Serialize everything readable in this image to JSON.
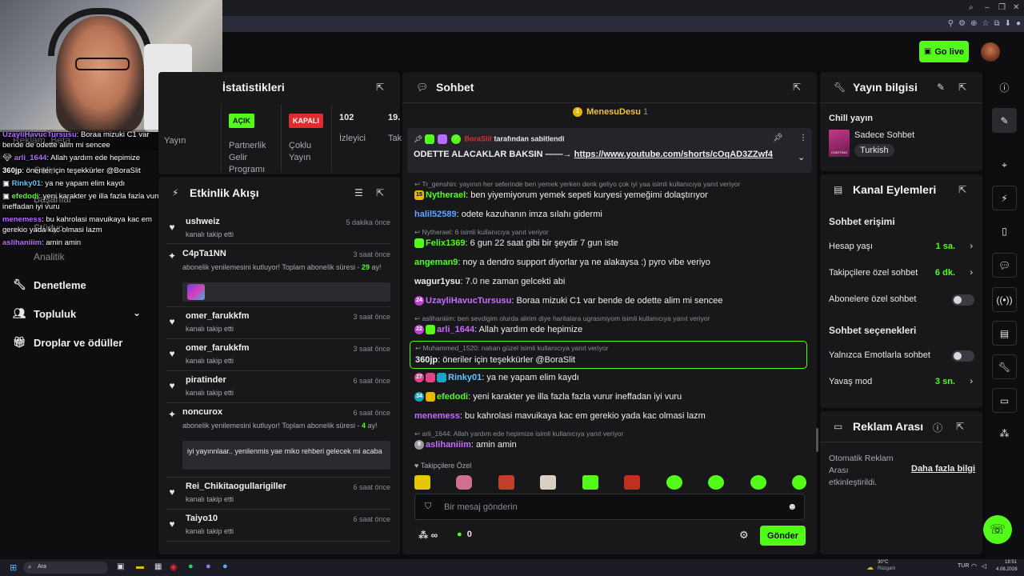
{
  "overlay_chat": [
    {
      "user": "UzayliHavucTursusu",
      "text": ": Boraa mizuki C1 var bende de odette alim mi sencee",
      "color": "#b56cff"
    },
    {
      "user": "arli_1644",
      "text": ": Allah yardım ede hepimize",
      "color": "#b56cff"
    },
    {
      "user": "360jp",
      "text": ": öneriler için teşekkürler @BoraSlit",
      "color": "#ffffff"
    },
    {
      "user": "Rinky01",
      "text": ": ya ne yapam elim kaydı",
      "color": "#5cc8ff"
    },
    {
      "user": "efedodi",
      "text": ": yeni karakter ye illa fazla fazla vurur ineffadan iyi vuru",
      "color": "#53fc18"
    },
    {
      "user": "menemess",
      "text": ": bu kahrolasi mavuikaya kac em gerekio yada kac olmasi lazm",
      "color": "#b56cff"
    },
    {
      "user": "aslihaniiim",
      "text": ": amin amin",
      "color": "#b56cff"
    }
  ],
  "nav": {
    "hidden_items": [
      "Reklam",
      "Beta",
      "Gelir",
      "Başarılar",
      "Stüdyo",
      "Analitik"
    ],
    "items": [
      {
        "label": "Denetleme",
        "icon": "wrench-icon"
      },
      {
        "label": "Topluluk",
        "icon": "users-icon"
      },
      {
        "label": "Droplar ve ödüller",
        "icon": "gift-icon"
      }
    ]
  },
  "header": {
    "go_live": "Go live"
  },
  "stats": {
    "title": "İstatistikleri",
    "col0": "Yayın",
    "cols": [
      {
        "tag": "AÇIK",
        "tag_color": "#53fc18",
        "label": "Partnerlik Gelir Programı"
      },
      {
        "tag": "KAPALI",
        "tag_color": "#e02c2c",
        "label": "Çoklu Yayın"
      },
      {
        "value": "102",
        "label": "İzleyici"
      },
      {
        "value": "19.",
        "label": "Tak"
      }
    ]
  },
  "activity": {
    "title": "Etkinlik Akışı",
    "rows": [
      {
        "name": "ushweiz",
        "sub": "kanalı takip etti",
        "time": "5 dakika önce",
        "icon": "heart-icon"
      },
      {
        "name": "C4pTa1NN",
        "sub": "abonelik yenilemesini kutluyor! Toplam abonelik süresi - ",
        "months": "29",
        "sub2": "ay!",
        "time": "3 saat önce",
        "icon": "star-icon"
      },
      {
        "name": "omer_farukkfm",
        "sub": "kanalı takip etti",
        "time": "3 saat önce",
        "icon": "heart-icon"
      },
      {
        "name": "omer_farukkfm",
        "sub": "kanalı takip etti",
        "time": "3 saat önce",
        "icon": "heart-icon"
      },
      {
        "name": "piratinder",
        "sub": "kanalı takip etti",
        "time": "6 saat önce",
        "icon": "heart-icon"
      },
      {
        "name": "noncurox",
        "sub": "abonelik yenilemesini kutluyor! Toplam abonelik süresi - ",
        "months": "4",
        "sub2": "ay!",
        "note": "iyi yayınnlaar.. yenilenmis yae miko rehberi gelecek mi acaba",
        "time": "6 saat önce",
        "icon": "star-icon"
      },
      {
        "name": "Rei_Chikitaogullarigiller",
        "sub": "kanalı takip etti",
        "time": "6 saat önce",
        "icon": "heart-icon"
      },
      {
        "name": "Taiyo10",
        "sub": "kanalı takip etti",
        "time": "6 saat önce",
        "icon": "heart-icon"
      }
    ]
  },
  "chat": {
    "title": "Sohbet",
    "top_gifter": "MenesuDesu",
    "top_gifter_count": "1",
    "pinned_by_user": "BoraSlit",
    "pinned_by_text": "tarafından sabitlendi",
    "pinned_text": "ODETTE ALACAKLAR BAKSIN ——→ ",
    "pinned_link": "https://www.youtube.com/shorts/cOqAD3ZZwf4",
    "messages": [
      {
        "reply": "Tr_genshin: yayının her seferinde ben yemek yerken denk geliyo çok iyi yaa isimli kullanıcıya yanıt veriyor"
      },
      {
        "badge": "15",
        "badge_color": "#e6b800",
        "user": "Nytherael",
        "color": "#53fc18",
        "text": ": ben yiyemiyorum yemek sepeti kuryesi yemeğimi dolaştırıyor"
      },
      {
        "user": "halil52589",
        "color": "#5ca8ff",
        "text": ": odete kazuhanın imza sılahı gidermi"
      },
      {
        "reply": "Nytherael: 6 isimli kullanıcıya yanıt veriyor"
      },
      {
        "badge": "",
        "badge_color": "#53fc18",
        "user": "Felix1369",
        "color": "#53fc18",
        "text": ": 6 gun 22 saat gibi bir şeydir 7 gun iste"
      },
      {
        "user": "angeman9",
        "color": "#53fc18",
        "text": ": noy a dendro support diyorlar ya ne alakaysa :) pyro vibe veriyo"
      },
      {
        "user": "wagur1ysu",
        "color": "#ffffff",
        "text": ": 7.0 ne zaman gelcekti abi"
      },
      {
        "badge": "24",
        "badge_color": "#c23fd6",
        "user": "UzayliHavucTursusu",
        "color": "#c56cff",
        "text": ": Boraa mizuki C1 var bende de odette alim mi sencee"
      },
      {
        "reply": "aslihaniiim: ben sevdigim olurda alirim diye haritalara ugrasmiyom isimli kullanıcıya yanıt veriyor"
      },
      {
        "badge": "22",
        "badge_color": "#c23fd6",
        "user": "arli_1644",
        "color": "#c56cff",
        "text": ": Allah yardım ede hepimize"
      },
      {
        "reply": "Muhammed_1520: natıan güzel isimli kullanıcıya yanıt veriyor",
        "highlight": true
      },
      {
        "user": "360jp",
        "color": "#ffffff",
        "text": ": öneriler için teşekkürler @BoraSlit",
        "highlight": true
      },
      {
        "badge": "27",
        "badge_color": "#e0458a",
        "user": "Rinky01",
        "color": "#5cc8ff",
        "text": ": ya ne yapam elim kaydı"
      },
      {
        "badge": "34",
        "badge_color": "#1aa3c9",
        "user": "efedodi",
        "color": "#53fc18",
        "text": ": yeni karakter ye illa fazla fazla vurur ineffadan iyi vuru"
      },
      {
        "user": "menemess",
        "color": "#c56cff",
        "text": ": bu kahrolasi mavuikaya kac em gerekio yada kac olmasi lazm"
      },
      {
        "reply": "arli_1644: Allah yardım ede hepimize isimli kullanıcıya yanıt veriyor"
      },
      {
        "badge": "9",
        "badge_color": "#9a9aa0",
        "user": "aslihaniiim",
        "color": "#c56cff",
        "text": ": amin amin"
      }
    ],
    "followers_only": "Takipçilere Özel",
    "input_placeholder": "Bir mesaj gönderin",
    "points": "∞",
    "kicks": "0",
    "send": "Gönder"
  },
  "info": {
    "title": "Yayın bilgisi",
    "stream_title": "Chill yayın",
    "category": "Sadece Sohbet",
    "language": "Turkish",
    "thumb_text": "CHATTING"
  },
  "actions": {
    "title": "Kanal Eylemleri",
    "section1": "Sohbet erişimi",
    "rows1": [
      {
        "label": "Hesap yaşı",
        "value": "1 sa."
      },
      {
        "label": "Takipçilere özel sohbet",
        "value": "6 dk."
      },
      {
        "label": "Abonelere özel sohbet",
        "toggle": true
      }
    ],
    "section2": "Sohbet seçenekleri",
    "rows2": [
      {
        "label": "Yalnızca Emotlarla sohbet",
        "toggle": true
      },
      {
        "label": "Yavaş mod",
        "value": "3 sn."
      }
    ]
  },
  "ads": {
    "title": "Reklam Arası",
    "desc": "Otomatik Reklam Arası etkinleştirildi.",
    "more": "Daha fazla bilgi"
  },
  "taskbar": {
    "search": "Ara",
    "weather_temp": "30°C",
    "weather_desc": "Rüzgarlı",
    "lang": "TUR",
    "time": "18:51",
    "date": "4.08.2026"
  },
  "colors": {
    "accent": "#53fc18",
    "panel": "#18181b",
    "bg": "#0b0b0d"
  }
}
